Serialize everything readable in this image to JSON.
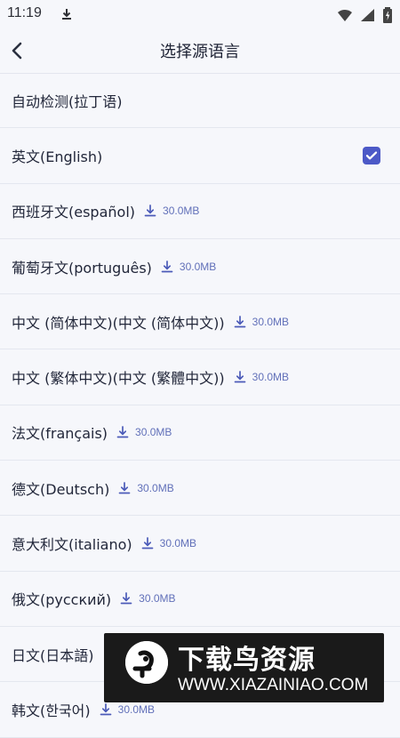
{
  "status": {
    "time": "11:19"
  },
  "header": {
    "title": "选择源语言"
  },
  "languages": [
    {
      "label": "自动检测(拉丁语)",
      "size": "",
      "checked": false
    },
    {
      "label": "英文(English)",
      "size": "",
      "checked": true
    },
    {
      "label": "西班牙文(español)",
      "size": "30.0MB",
      "checked": false
    },
    {
      "label": "葡萄牙文(português)",
      "size": "30.0MB",
      "checked": false
    },
    {
      "label": "中文 (简体中文)(中文 (简体中文))",
      "size": "30.0MB",
      "checked": false
    },
    {
      "label": "中文 (繁体中文)(中文 (繁體中文))",
      "size": "30.0MB",
      "checked": false
    },
    {
      "label": "法文(français)",
      "size": "30.0MB",
      "checked": false
    },
    {
      "label": "德文(Deutsch)",
      "size": "30.0MB",
      "checked": false
    },
    {
      "label": "意大利文(italiano)",
      "size": "30.0MB",
      "checked": false
    },
    {
      "label": "俄文(русский)",
      "size": "30.0MB",
      "checked": false
    },
    {
      "label": "日文(日本語)",
      "size": "",
      "checked": false
    },
    {
      "label": "韩文(한국어)",
      "size": "30.0MB",
      "checked": false
    }
  ],
  "watermark": {
    "title": "下载鸟资源",
    "url": "WWW.XIAZAINIAO.COM"
  },
  "colors": {
    "accent": "#4c59c7",
    "background": "#f6f7fb",
    "divider": "#e4e7ef"
  }
}
